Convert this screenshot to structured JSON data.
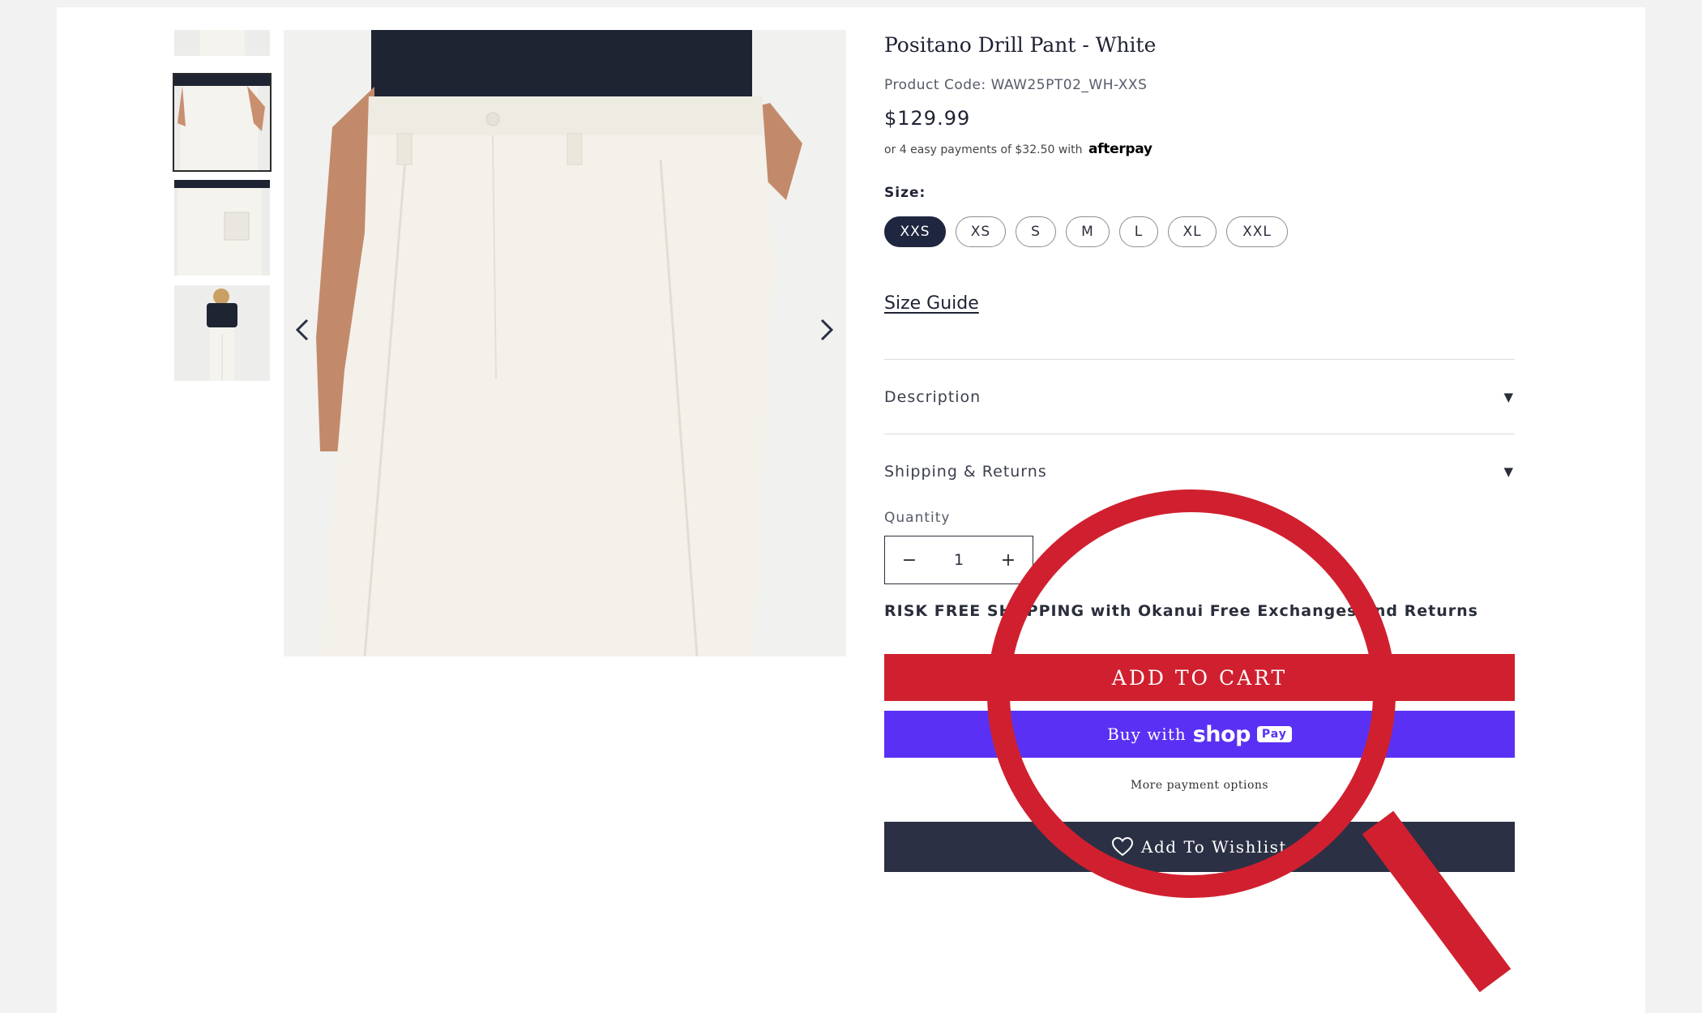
{
  "product": {
    "title": "Positano Drill Pant - White",
    "code": "Product Code: WAW25PT02_WH-XXS",
    "price": "$129.99",
    "afterpay_text": "or 4 easy payments of $32.50 with",
    "afterpay_logo": "afterpay",
    "size_label": "Size:",
    "sizes": [
      "XXS",
      "XS",
      "S",
      "M",
      "L",
      "XL",
      "XXL"
    ],
    "selected_size": "XXS",
    "size_guide": "Size Guide"
  },
  "accordions": {
    "description": "Description",
    "shipping": "Shipping & Returns",
    "caret": "▼"
  },
  "quantity": {
    "label": "Quantity",
    "value": "1",
    "minus": "−",
    "plus": "+"
  },
  "risk_text": "RISK FREE SHOPPING with Okanui Free Exchanges and Returns",
  "buttons": {
    "add_to_cart": "ADD TO CART",
    "buy_with": "Buy with",
    "shop_logo": "shop",
    "pay_badge": "Pay",
    "more_payment": "More payment options",
    "wishlist": "Add To Wishlist"
  },
  "colors": {
    "accent_red": "#d0202f",
    "shop_purple": "#5a31f4",
    "navy": "#2c3044"
  }
}
